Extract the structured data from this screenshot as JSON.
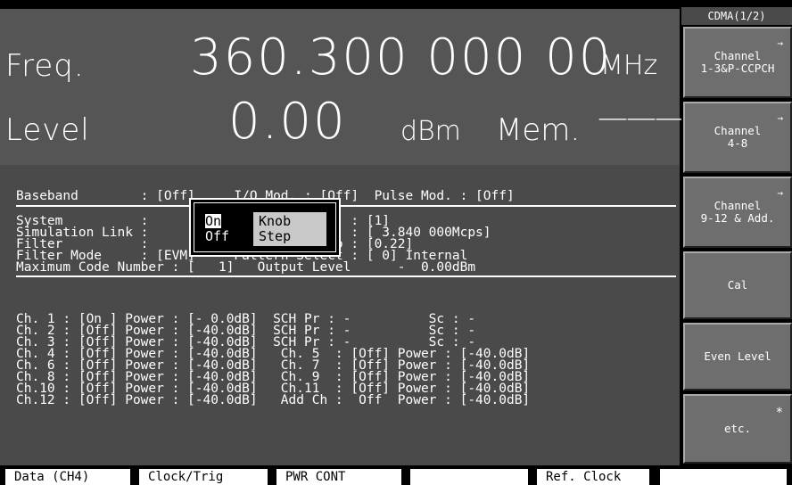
{
  "display": {
    "freq_label": "Freq.",
    "freq_value": "360.300 000 00",
    "freq_unit": "MHz",
    "level_label": "Level",
    "level_value": "0.00",
    "level_unit": "dBm",
    "mem_label": "Mem.",
    "mem_value": "———"
  },
  "params": {
    "baseband_line": "Baseband        : [Off]     I/Q Mod. : [Off]  Pulse Mod. : [Off]",
    "system_line": "System          :           W-CDMA Phase   : [1]",
    "simlink_line": "Simulation Link :           Chip Rate      : [ 3.840 000Mcps]",
    "filter_line": "Filter          :           Roll Off Ratio : [0.22]",
    "filtermode_line": "Filter Mode     : [EVM]     Pattern Select : [ 0] Internal",
    "maxcode_line": "Maximum Code Number : [   1]   Output Level      -  0.00dBm",
    "ch_lines": [
      "Ch. 1 : [On ] Power : [- 0.0dB]  SCH Pr : -          Sc : -",
      "Ch. 2 : [Off] Power : [-40.0dB]  SCH Pr : -          Sc : -",
      "Ch. 3 : [Off] Power : [-40.0dB]  SCH Pr : -          Sc : -",
      "Ch. 4 : [Off] Power : [-40.0dB]   Ch. 5  : [Off] Power : [-40.0dB]",
      "Ch. 6 : [Off] Power : [-40.0dB]   Ch. 7  : [Off] Power : [-40.0dB]",
      "Ch. 8 : [Off] Power : [-40.0dB]   Ch. 9  : [Off] Power : [-40.0dB]",
      "Ch.10 : [Off] Power : [-40.0dB]   Ch.11  : [Off] Power : [-40.0dB]",
      "Ch.12 : [Off] Power : [-40.0dB]   Add Ch :  Off  Power : [-40.0dB]"
    ]
  },
  "popup": {
    "on": "On",
    "off": "Off",
    "knob": "Knob",
    "step": "Step"
  },
  "softkeys": {
    "title": "CDMA(1/2)",
    "keys": [
      {
        "label": "Channel\n1-3&P-CCPCH",
        "arrow": "→"
      },
      {
        "label": "Channel\n4-8",
        "arrow": "→"
      },
      {
        "label": "Channel\n9-12 & Add.",
        "arrow": "→"
      },
      {
        "label": "Cal",
        "arrow": ""
      },
      {
        "label": "Even Level",
        "arrow": ""
      },
      {
        "label": "etc.",
        "arrow": "*"
      }
    ]
  },
  "statusbar": {
    "data": "Data (CH4)",
    "clock": "Clock/Trig",
    "pwr": "PWR CONT",
    "blank": "",
    "ref": "Ref. Clock",
    "blank2": ""
  }
}
